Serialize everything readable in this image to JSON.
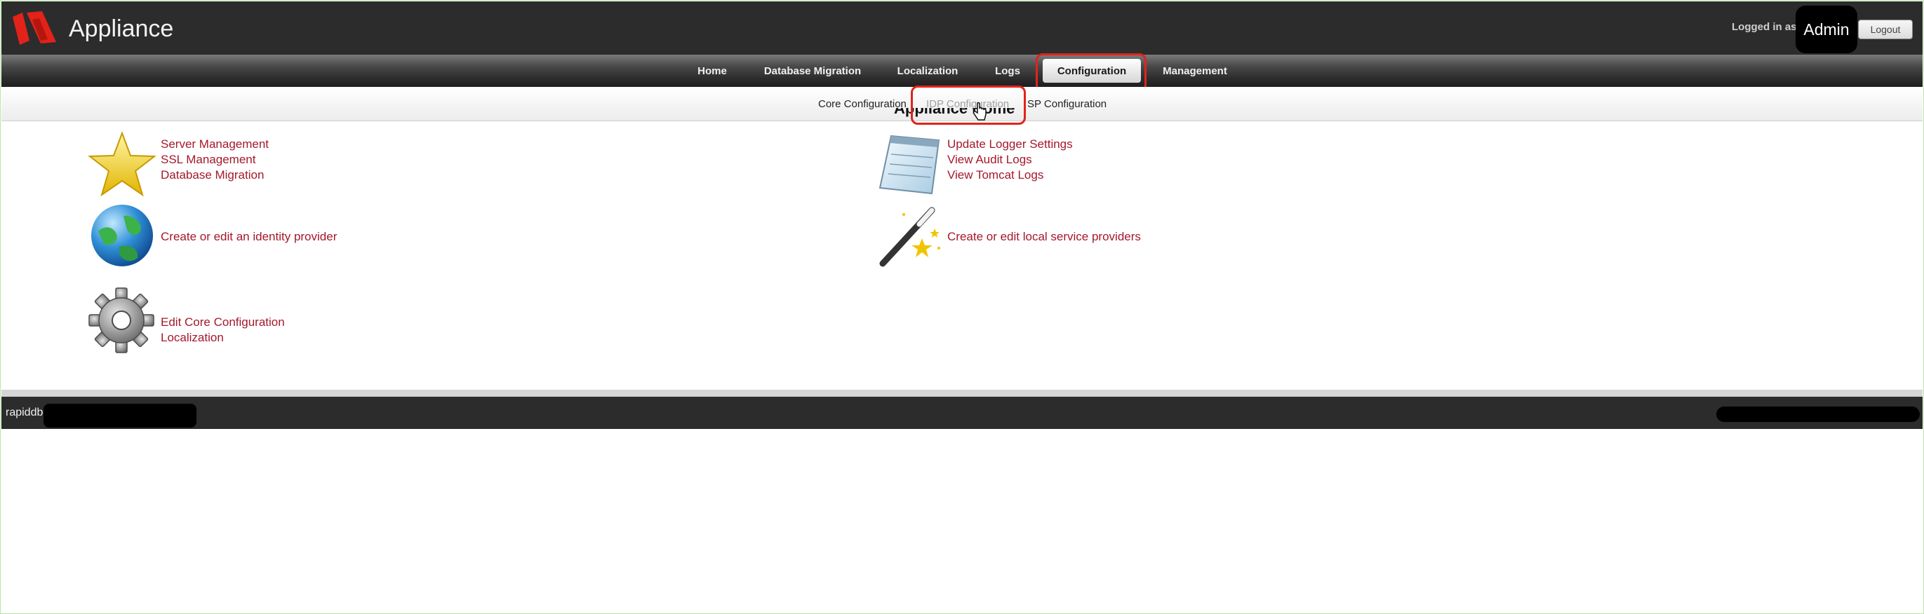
{
  "header": {
    "app_title": "Appliance",
    "logged_in_label": "Logged in as",
    "user": "Admin",
    "logout_label": "Logout"
  },
  "nav": {
    "items": [
      {
        "label": "Home"
      },
      {
        "label": "Database Migration"
      },
      {
        "label": "Localization"
      },
      {
        "label": "Logs"
      },
      {
        "label": "Configuration",
        "active": true
      },
      {
        "label": "Management"
      }
    ]
  },
  "subnav": {
    "items": [
      {
        "label": "Core Configuration"
      },
      {
        "label": "IDP Configuration",
        "disabled": true
      },
      {
        "label": "SP Configuration"
      }
    ]
  },
  "main": {
    "heading": "Appliance Home",
    "sections": {
      "server": {
        "icon": "star-icon",
        "links": [
          "Server Management",
          "SSL Management",
          "Database Migration"
        ]
      },
      "logs": {
        "icon": "notepad-icon",
        "links": [
          "Update Logger Settings",
          "View Audit Logs",
          "View Tomcat Logs"
        ]
      },
      "idp": {
        "icon": "globe-icon",
        "links": [
          "Create or edit an identity provider"
        ]
      },
      "sp": {
        "icon": "magic-wand-icon",
        "links": [
          "Create or edit local service providers"
        ]
      },
      "core": {
        "icon": "gear-icon",
        "links": [
          "Edit Core Configuration",
          "Localization"
        ]
      }
    }
  },
  "footer": {
    "text": "rapiddb"
  },
  "colors": {
    "link": "#a3192b",
    "header_bg": "#2c2c2c",
    "highlight": "#e0241c"
  }
}
